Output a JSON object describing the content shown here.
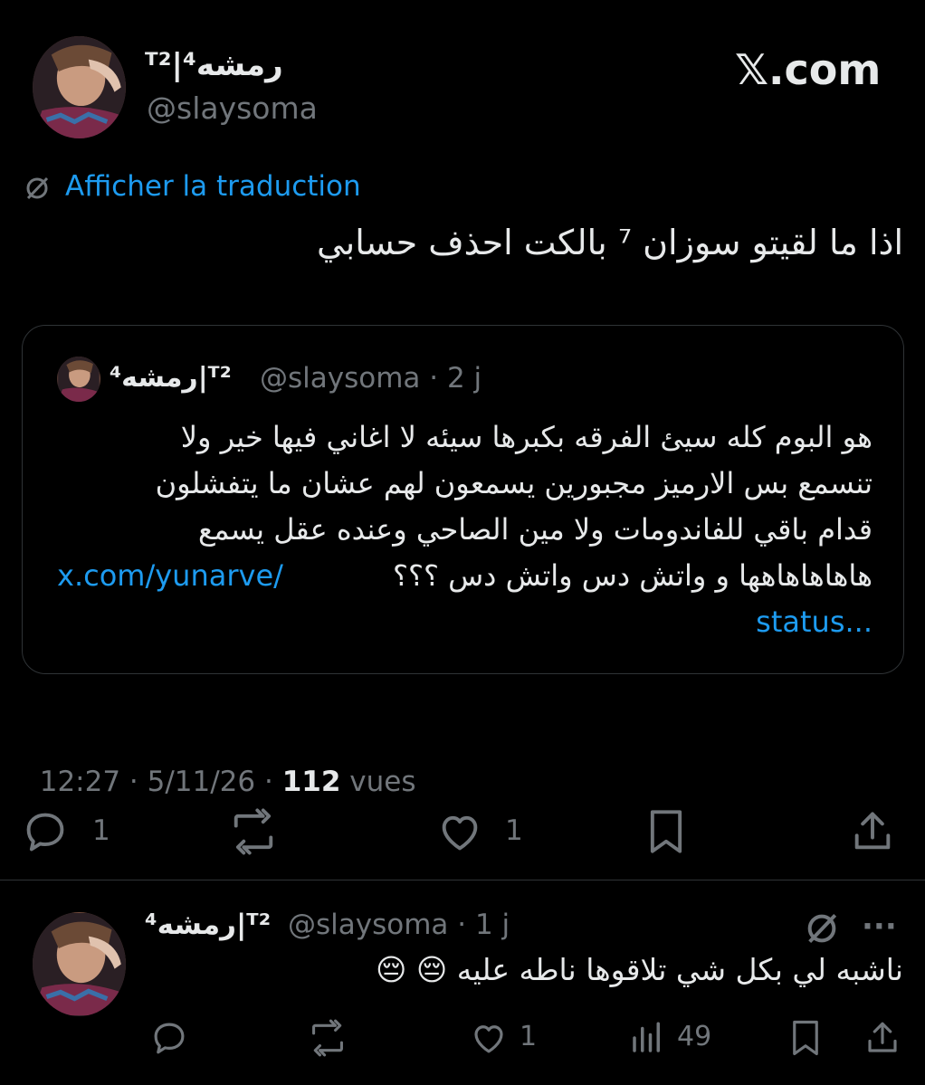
{
  "header": {
    "display_name": "رمشه⁴|ᵀ²",
    "handle": "@slaysoma",
    "brand": "𝕏.com"
  },
  "tweet": {
    "translate_label": "Afficher la traduction",
    "text": "اذا ما لقيتو سوزان ⁷ بالكت احذف حسابي",
    "meta": {
      "time": "12:27",
      "sep1": " · ",
      "date": "5/11/26",
      "sep2": " · ",
      "views_count": "112",
      "views_label": "vues"
    },
    "actions": {
      "reply_count": "1",
      "like_count": "1"
    }
  },
  "quote": {
    "display_name": "رمشه⁴|ᵀ²",
    "handle_time": "@slaysoma · 2 j",
    "lines": [
      "هو البوم كله سيئ الفرقه بكبرها سيئه لا اغاني فيها خير ولا",
      "تنسمع بس الارميز مجبورين يسمعون لهم عشان ما يتفشلون",
      "قدام باقي للفاندومات ولا مين الصاحي وعنده عقل يسمع",
      "هاهاهاهاهها و واتش دس واتش دس ؟؟؟"
    ],
    "link_part1": "x.com/yunarve/",
    "link_part2": "status..."
  },
  "reply": {
    "display_name": "رمشه⁴|ᵀ²",
    "handle_time": "@slaysoma · 1 j",
    "text": "ناشبه لي بكل شي تلاقوها ناطه عليه 😔 😔",
    "actions": {
      "like_count": "1",
      "views_count": "49"
    },
    "more_label": "···"
  }
}
